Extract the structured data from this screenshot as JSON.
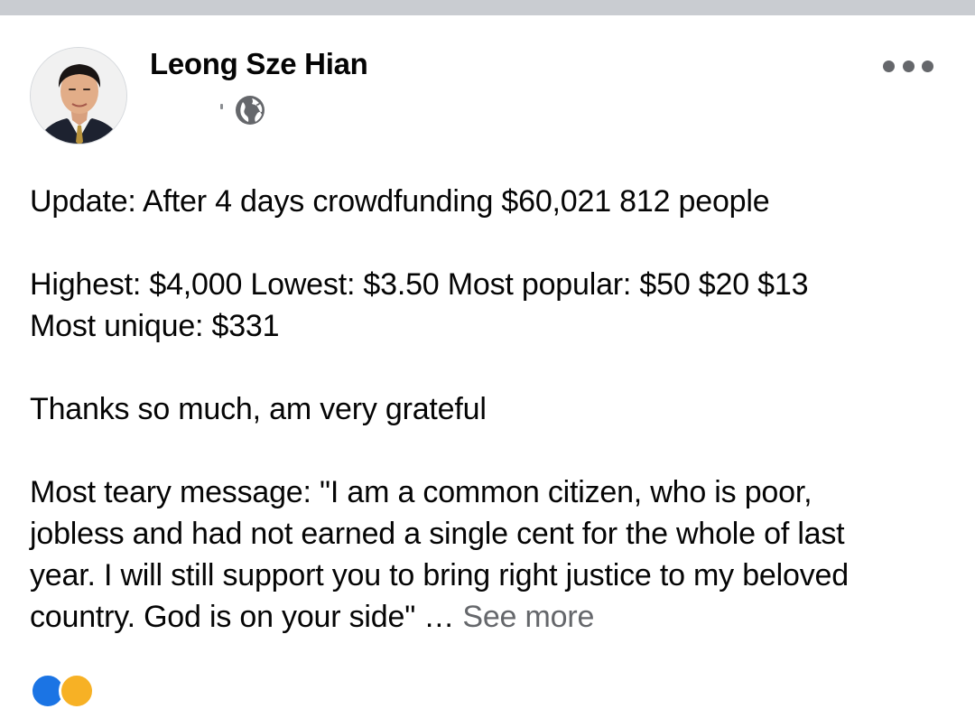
{
  "post": {
    "author": "Leong Sze Hian",
    "audience_icon": "globe-icon",
    "more_icon": "more-horizontal-icon",
    "paragraphs": [
      [
        "Update: After 4 days crowdfunding $60,021 812 people"
      ],
      [
        "Highest: $4,000 Lowest: $3.50 Most popular: $50 $20 $13",
        "Most unique: $331"
      ],
      [
        "Thanks so much, am very grateful"
      ],
      [
        "Most teary message: \"I am a common citizen, who is poor,",
        "jobless and had not earned a single cent for the whole of last",
        "year. I will still support you to bring right justice to my beloved"
      ]
    ],
    "last_line": "country. God is on your side\" … ",
    "see_more": "See more",
    "reactions": [
      "like-reaction-icon",
      "care-reaction-icon"
    ]
  },
  "colors": {
    "top_bar": "#c9ccd1",
    "text": "#050505",
    "secondary_text": "#65676b",
    "like_blue": "#1b74e4",
    "care_yellow": "#f7b125"
  }
}
